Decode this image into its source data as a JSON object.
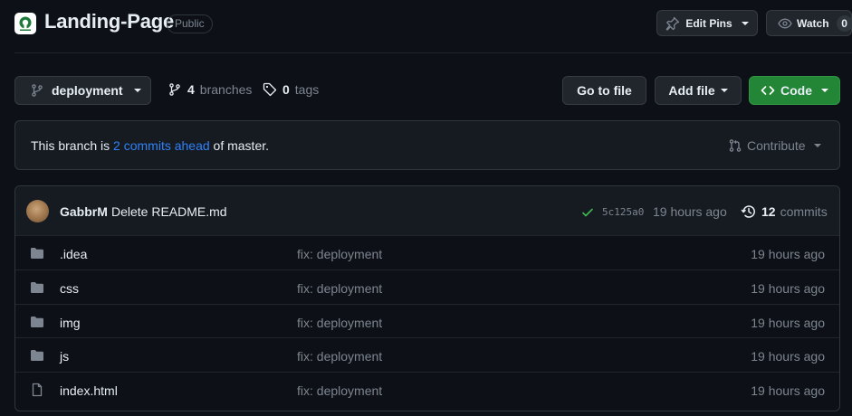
{
  "repo": {
    "name": "Landing-Page",
    "visibility": "Public",
    "logo_icon": "repo-logo-icon"
  },
  "header_actions": {
    "edit_pins_label": "Edit Pins",
    "watch_label": "Watch",
    "watch_count": "0"
  },
  "toolbar": {
    "branch_name": "deployment",
    "branches_count": "4",
    "branches_label": "branches",
    "tags_count": "0",
    "tags_label": "tags",
    "go_to_file_label": "Go to file",
    "add_file_label": "Add file",
    "code_label": "Code"
  },
  "ahead_notice": {
    "prefix": "This branch is ",
    "link_text": "2 commits ahead",
    "suffix": " of master.",
    "contribute_label": "Contribute"
  },
  "latest_commit": {
    "author": "GabbrM",
    "message": "Delete README.md",
    "sha": "5c125a0",
    "time": "19 hours ago",
    "commits_count": "12",
    "commits_label": "commits"
  },
  "files": [
    {
      "type": "folder",
      "name": ".idea",
      "message": "fix: deployment",
      "time": "19 hours ago"
    },
    {
      "type": "folder",
      "name": "css",
      "message": "fix: deployment",
      "time": "19 hours ago"
    },
    {
      "type": "folder",
      "name": "img",
      "message": "fix: deployment",
      "time": "19 hours ago"
    },
    {
      "type": "folder",
      "name": "js",
      "message": "fix: deployment",
      "time": "19 hours ago"
    },
    {
      "type": "file",
      "name": "index.html",
      "message": "fix: deployment",
      "time": "19 hours ago"
    }
  ],
  "colors": {
    "background": "#0d1117",
    "accent_link": "#2f81f7",
    "code_button": "#238636",
    "success_check": "#3fb950"
  }
}
